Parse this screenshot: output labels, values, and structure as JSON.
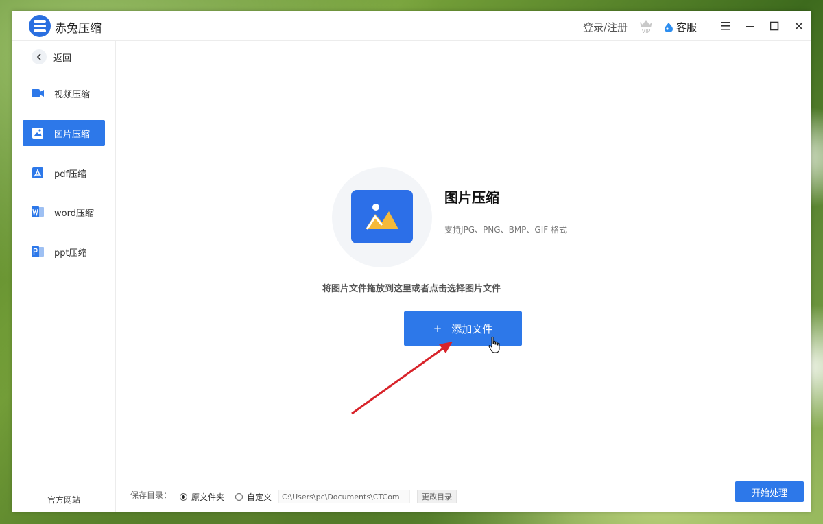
{
  "app": {
    "title": "赤兔压缩"
  },
  "header": {
    "login": "登录/注册",
    "vip": "VIP",
    "service": "客服"
  },
  "sidebar": {
    "back": "返回",
    "items": [
      {
        "label": "视频压缩",
        "icon": "video-icon"
      },
      {
        "label": "图片压缩",
        "icon": "image-icon",
        "active": true
      },
      {
        "label": "pdf压缩",
        "icon": "pdf-icon"
      },
      {
        "label": "word压缩",
        "icon": "word-icon"
      },
      {
        "label": "ppt压缩",
        "icon": "ppt-icon"
      }
    ],
    "site": "官方网站"
  },
  "main": {
    "title": "图片压缩",
    "subtitle": "支持JPG、PNG、BMP、GIF 格式",
    "hint": "将图片文件拖放到这里或者点击选择图片文件",
    "add_plus": "+",
    "add_label": "添加文件"
  },
  "footer": {
    "save_label": "保存目录：",
    "option_original": "原文件夹",
    "option_custom": "自定义",
    "path": "C:\\Users\\pc\\Documents\\CTCom",
    "change": "更改目录",
    "start": "开始处理"
  },
  "colors": {
    "accent": "#2d78e9",
    "annotation_arrow": "#d8232a"
  }
}
